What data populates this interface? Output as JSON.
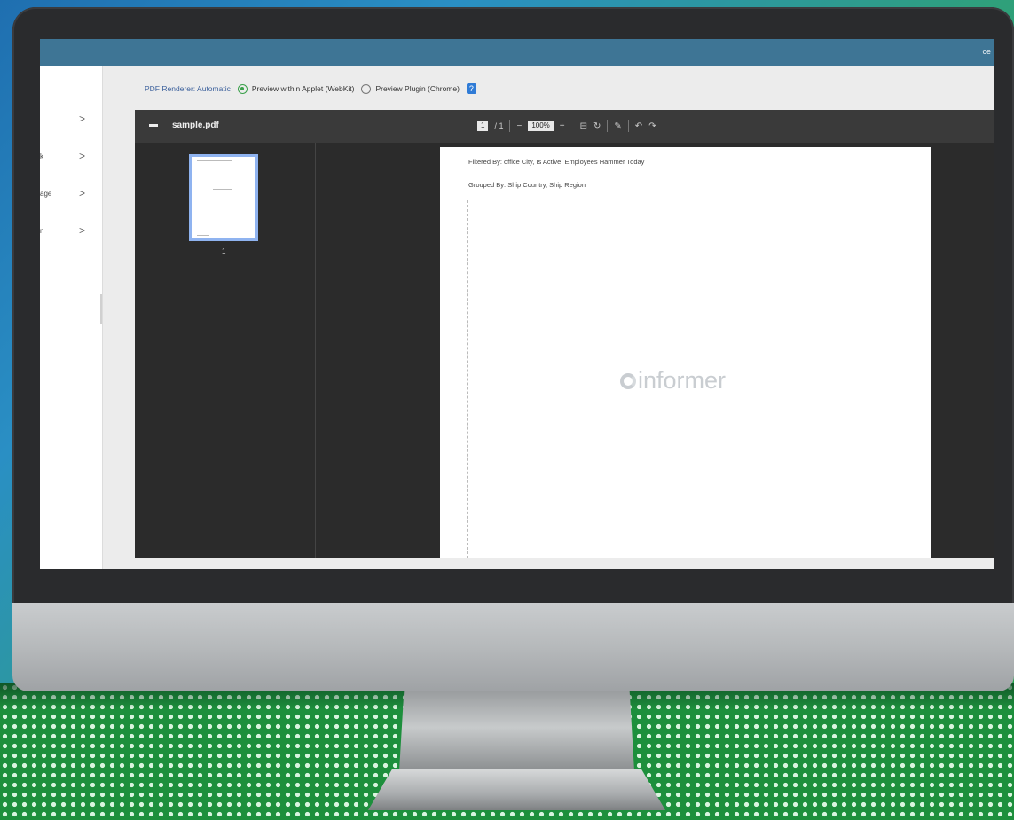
{
  "topbar": {
    "text": "ce"
  },
  "sidebar": {
    "items": [
      {
        "label": "",
        "chevron": ">"
      },
      {
        "label": "k",
        "chevron": ">"
      },
      {
        "label": "age",
        "chevron": ">"
      },
      {
        "label": "n",
        "chevron": ">"
      }
    ]
  },
  "options": {
    "label": "PDF Renderer: Automatic",
    "option1": "Preview within Applet (WebKit)",
    "option2": "Preview Plugin (Chrome)",
    "help": "?"
  },
  "viewer": {
    "filename": "sample.pdf",
    "page_current": "1",
    "page_total": "/ 1",
    "zoom": "100%",
    "zoom_out": "−",
    "zoom_in": "+",
    "thumb_number": "1"
  },
  "page": {
    "line1": "Filtered By: office City, Is Active, Employees Hammer Today",
    "line2": "Grouped By: Ship Country, Ship Region",
    "watermark": "informer"
  },
  "colors": {
    "topbar": "#3e7595",
    "radio_on": "#3aa04a",
    "help": "#2f7bd6"
  }
}
